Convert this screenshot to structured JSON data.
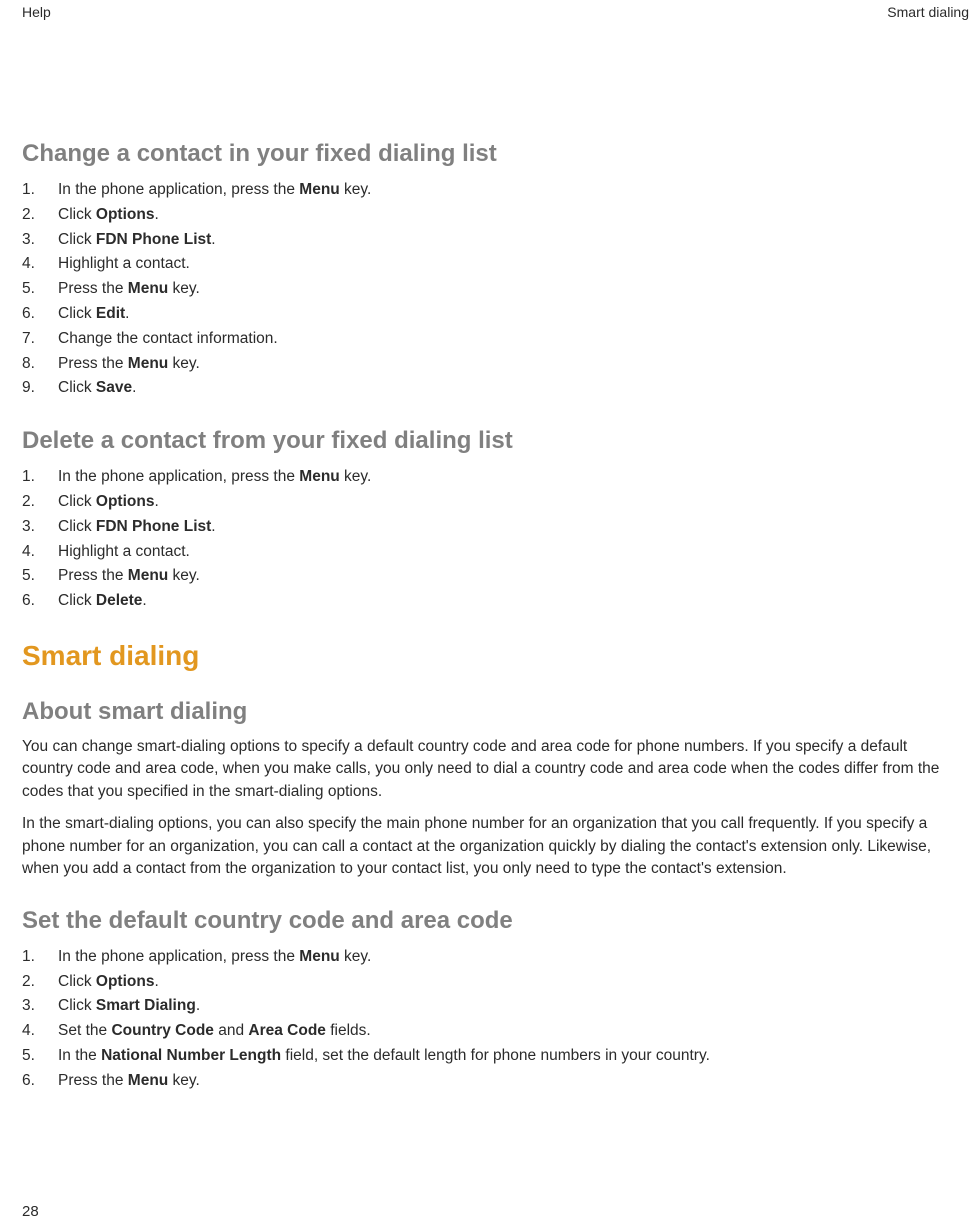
{
  "header": {
    "left": "Help",
    "right": "Smart dialing"
  },
  "section1": {
    "title": "Change a contact in your fixed dialing list",
    "items": [
      {
        "pre": "In the phone application, press the ",
        "b1": "Menu",
        "post": " key."
      },
      {
        "pre": "Click ",
        "b1": "Options",
        "post": "."
      },
      {
        "pre": "Click ",
        "b1": "FDN Phone List",
        "post": "."
      },
      {
        "pre": "Highlight a contact.",
        "b1": "",
        "post": ""
      },
      {
        "pre": "Press the ",
        "b1": "Menu",
        "post": " key."
      },
      {
        "pre": "Click ",
        "b1": "Edit",
        "post": "."
      },
      {
        "pre": "Change the contact information.",
        "b1": "",
        "post": ""
      },
      {
        "pre": "Press the ",
        "b1": "Menu",
        "post": " key."
      },
      {
        "pre": "Click ",
        "b1": "Save",
        "post": "."
      }
    ]
  },
  "section2": {
    "title": "Delete a contact from your fixed dialing list",
    "items": [
      {
        "pre": "In the phone application, press the ",
        "b1": "Menu",
        "post": " key."
      },
      {
        "pre": "Click ",
        "b1": "Options",
        "post": "."
      },
      {
        "pre": "Click ",
        "b1": "FDN Phone List",
        "post": "."
      },
      {
        "pre": "Highlight a contact.",
        "b1": "",
        "post": ""
      },
      {
        "pre": "Press the ",
        "b1": "Menu",
        "post": " key."
      },
      {
        "pre": "Click ",
        "b1": "Delete",
        "post": "."
      }
    ]
  },
  "section3": {
    "title": "Smart dialing"
  },
  "section4": {
    "title": "About smart dialing",
    "para1": "You can change smart-dialing options to specify a default country code and area code for phone numbers. If you specify a default country code and area code, when you make calls, you only need to dial a country code and area code when the codes differ from the codes that you specified in the smart-dialing options.",
    "para2": "In the smart-dialing options, you can also specify the main phone number for an organization that you call frequently. If you specify a phone number for an organization, you can call a contact at the organization quickly by dialing the contact's extension only. Likewise, when you add a contact from the organization to your contact list, you only need to type the contact's extension."
  },
  "section5": {
    "title": "Set the default country code and area code",
    "items": [
      {
        "pre": "In the phone application, press the ",
        "b1": "Menu",
        "post": " key."
      },
      {
        "pre": "Click ",
        "b1": "Options",
        "post": "."
      },
      {
        "pre": "Click ",
        "b1": "Smart Dialing",
        "post": "."
      },
      {
        "pre": "Set the ",
        "b1": "Country Code",
        "mid": " and ",
        "b2": "Area Code",
        "post": " fields."
      },
      {
        "pre": "In the ",
        "b1": "National Number Length",
        "post": " field, set the default length for phone numbers in your country."
      },
      {
        "pre": "Press the ",
        "b1": "Menu",
        "post": " key."
      }
    ]
  },
  "page_number": "28"
}
